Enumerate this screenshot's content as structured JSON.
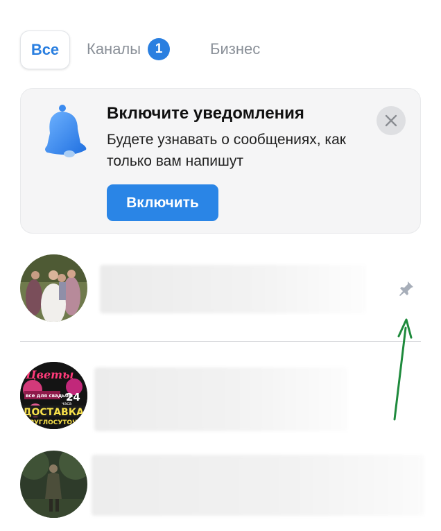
{
  "tabs": {
    "all": "Все",
    "channels": "Каналы",
    "channels_badge": "1",
    "business": "Бизнес"
  },
  "banner": {
    "title": "Включите уведомления",
    "text": "Будете узнавать о сообщениях, как только вам напишут",
    "button": "Включить",
    "icon": "bell-icon",
    "close_icon": "close-icon"
  },
  "chats": [
    {
      "avatar": "wedding-group-photo",
      "name_hidden": true,
      "pinned": true,
      "icon": "pin-icon"
    },
    {
      "avatar": "flower-delivery-logo",
      "name_hidden": true,
      "avatar_text": {
        "title": "Цветы",
        "line2": "все для свадьбы",
        "hours": "24",
        "hours_unit": "часа",
        "line3": "ДОСТАВКА",
        "line4": "КРУГЛОСУТОЧНО"
      }
    },
    {
      "avatar": "person-in-park-photo",
      "name_hidden": true
    }
  ],
  "colors": {
    "accent": "#2a7fe0",
    "banner_bg": "#f5f5f6",
    "arrow": "#1e8a3c"
  }
}
